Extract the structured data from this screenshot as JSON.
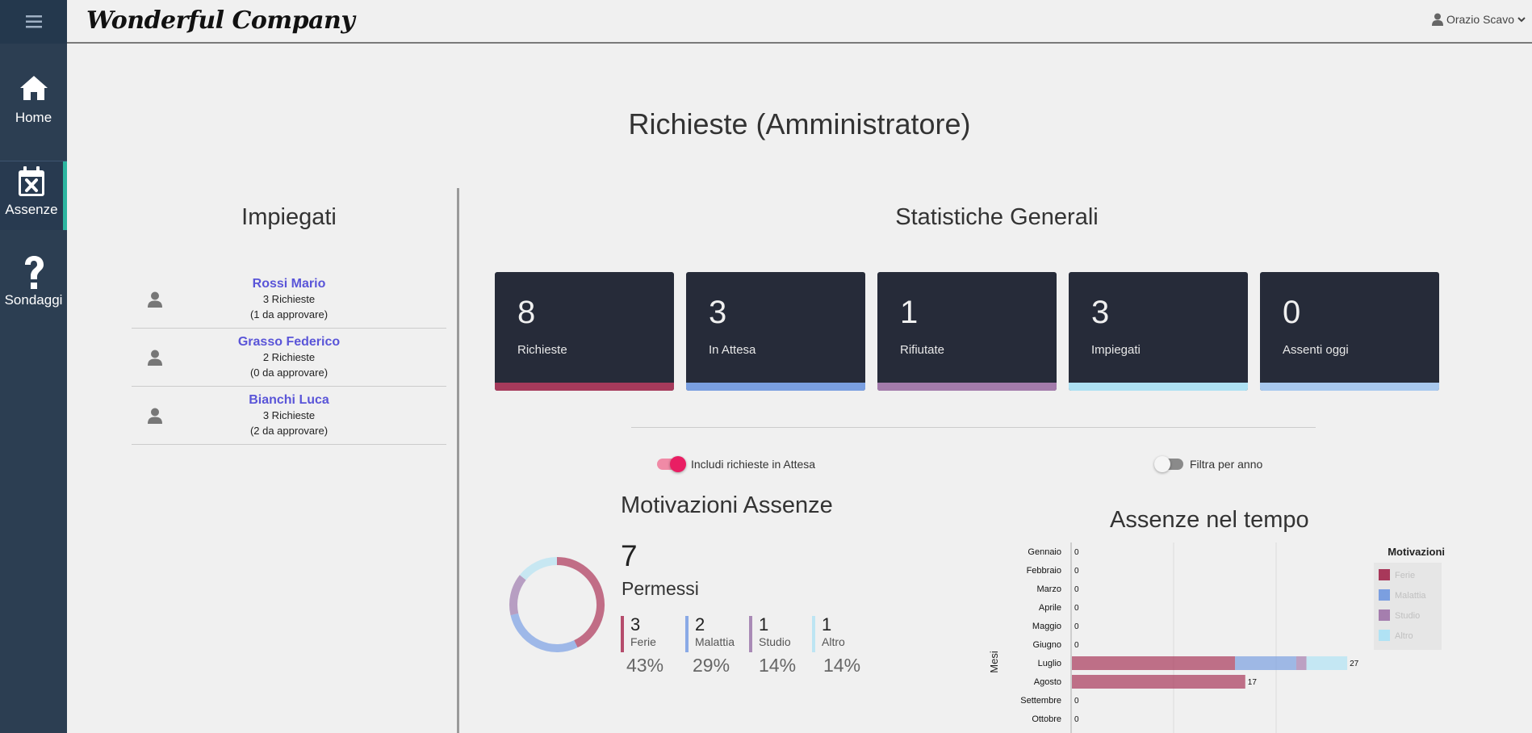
{
  "header": {
    "brand": "Wonderful Company",
    "user_name": "Orazio Scavo"
  },
  "sidebar": {
    "items": [
      {
        "label": "Home",
        "icon": "home-icon"
      },
      {
        "label": "Assenze",
        "icon": "calendar-x-icon",
        "active": true
      },
      {
        "label": "Sondaggi",
        "icon": "question-icon"
      }
    ]
  },
  "page": {
    "title": "Richieste (Amministratore)"
  },
  "employees": {
    "title": "Impiegati",
    "list": [
      {
        "name": "Rossi Mario",
        "requests": "3 Richieste",
        "pending": "(1 da approvare)"
      },
      {
        "name": "Grasso Federico",
        "requests": "2 Richieste",
        "pending": "(0 da approvare)"
      },
      {
        "name": "Bianchi Luca",
        "requests": "3 Richieste",
        "pending": "(2 da approvare)"
      }
    ]
  },
  "stats": {
    "title": "Statistiche Generali",
    "cards": [
      {
        "value": "8",
        "label": "Richieste",
        "color": "#a53a5b"
      },
      {
        "value": "3",
        "label": "In Attesa",
        "color": "#7a9fe0"
      },
      {
        "value": "1",
        "label": "Rifiutate",
        "color": "#a37bab"
      },
      {
        "value": "3",
        "label": "Impiegati",
        "color": "#aee1f3"
      },
      {
        "value": "0",
        "label": "Assenti oggi",
        "color": "#a8c8ee"
      }
    ]
  },
  "toggles": {
    "include_pending": {
      "label": "Includi richieste in Attesa",
      "on": true
    },
    "filter_year": {
      "label": "Filtra per anno",
      "on": false
    }
  },
  "motivazioni": {
    "title": "Motivazioni Assenze",
    "total": "7",
    "unit": "Permessi",
    "items": [
      {
        "count": "3",
        "label": "Ferie",
        "pct": "43%",
        "color": "#b54c6c"
      },
      {
        "count": "2",
        "label": "Malattia",
        "pct": "29%",
        "color": "#8aaae6"
      },
      {
        "count": "1",
        "label": "Studio",
        "pct": "14%",
        "color": "#a98ab6"
      },
      {
        "count": "1",
        "label": "Altro",
        "pct": "14%",
        "color": "#bde5f3"
      }
    ]
  },
  "chart_data": {
    "type": "bar",
    "title": "Assenze nel tempo",
    "orientation": "horizontal",
    "stacked": true,
    "ylabel": "Mesi",
    "categories": [
      "Gennaio",
      "Febbraio",
      "Marzo",
      "Aprile",
      "Maggio",
      "Giugno",
      "Luglio",
      "Agosto",
      "Settembre",
      "Ottobre"
    ],
    "totals": [
      "0",
      "0",
      "0",
      "0",
      "0",
      "0",
      "27",
      "17",
      "0",
      "0"
    ],
    "xlim": [
      0,
      30
    ],
    "series": [
      {
        "name": "Ferie",
        "color": "#a8385a",
        "values": [
          0,
          0,
          0,
          0,
          0,
          0,
          16,
          17,
          0,
          0
        ]
      },
      {
        "name": "Malattia",
        "color": "#7b9fe0",
        "values": [
          0,
          0,
          0,
          0,
          0,
          0,
          6,
          0,
          0,
          0
        ]
      },
      {
        "name": "Studio",
        "color": "#a57eae",
        "values": [
          0,
          0,
          0,
          0,
          0,
          0,
          1,
          0,
          0,
          0
        ]
      },
      {
        "name": "Altro",
        "color": "#b0e2f4",
        "values": [
          0,
          0,
          0,
          0,
          0,
          0,
          4,
          0,
          0,
          0
        ]
      }
    ],
    "legend_title": "Motivazioni",
    "legend_position": "right"
  }
}
